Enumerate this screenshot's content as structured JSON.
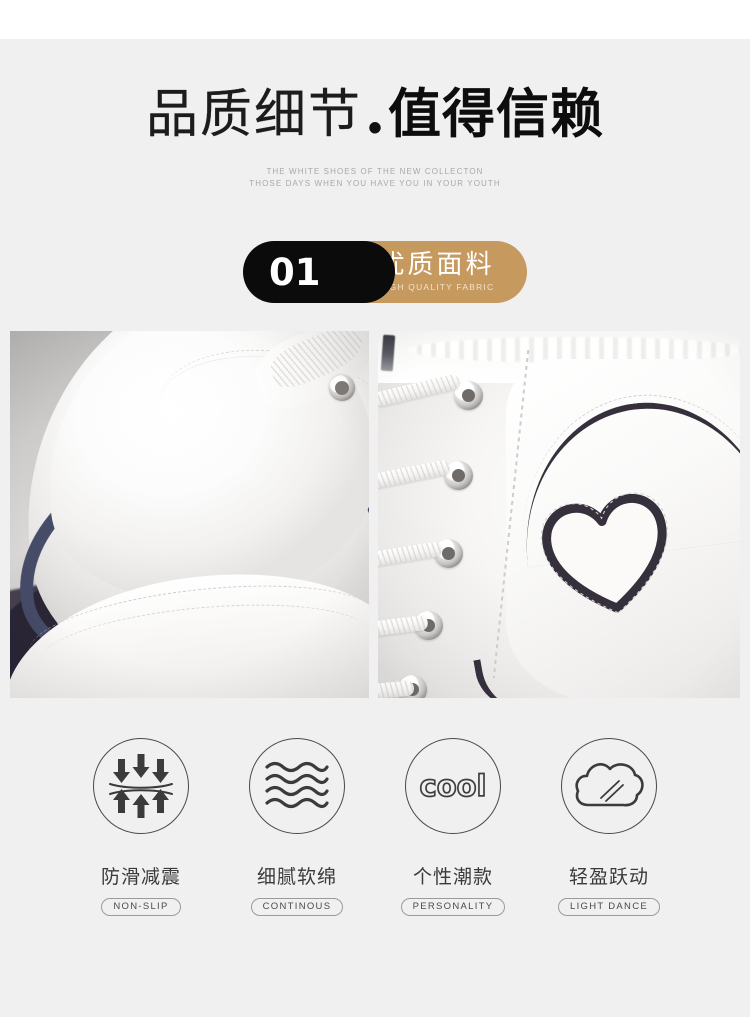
{
  "page": {
    "background_color": "#f0f0f0",
    "top_strip_color": "#ffffff"
  },
  "header": {
    "title_thin": "品质细节",
    "title_separator": "•",
    "title_bold": "值得信赖",
    "subtitle_line1": "THE WHITE SHOES OF THE NEW COLLECTON",
    "subtitle_line2": "THOSE DAYS WHEN YOU HAVE YOU IN YOUR YOUTH"
  },
  "section_badge": {
    "number": "01",
    "title_cn": "优质面料",
    "title_en": "HIGH QUALITY FABRIC",
    "gold_color": "#c69a5f",
    "black_color": "#0b0b0b"
  },
  "gallery": {
    "photos": [
      {
        "alt": "Close-up of white leather sneaker toe cap with navy blue trim stripe and stitching",
        "accent_color": "#3c4160"
      },
      {
        "alt": "Close-up of white high-top sneaker side panel with navy heart applique and laced eyelets",
        "accent_color": "#35303c"
      }
    ]
  },
  "features": [
    {
      "icon": "shock-absorption-icon",
      "label_cn": "防滑减震",
      "label_en": "NON-SLIP"
    },
    {
      "icon": "wavy-lines-icon",
      "label_cn": "细腻软绵",
      "label_en": "CONTINOUS"
    },
    {
      "icon": "cool-text-icon",
      "icon_text": "cool",
      "label_cn": "个性潮款",
      "label_en": "PERSONALITY"
    },
    {
      "icon": "cloud-motion-icon",
      "label_cn": "轻盈跃动",
      "label_en": "LIGHT DANCE"
    }
  ]
}
